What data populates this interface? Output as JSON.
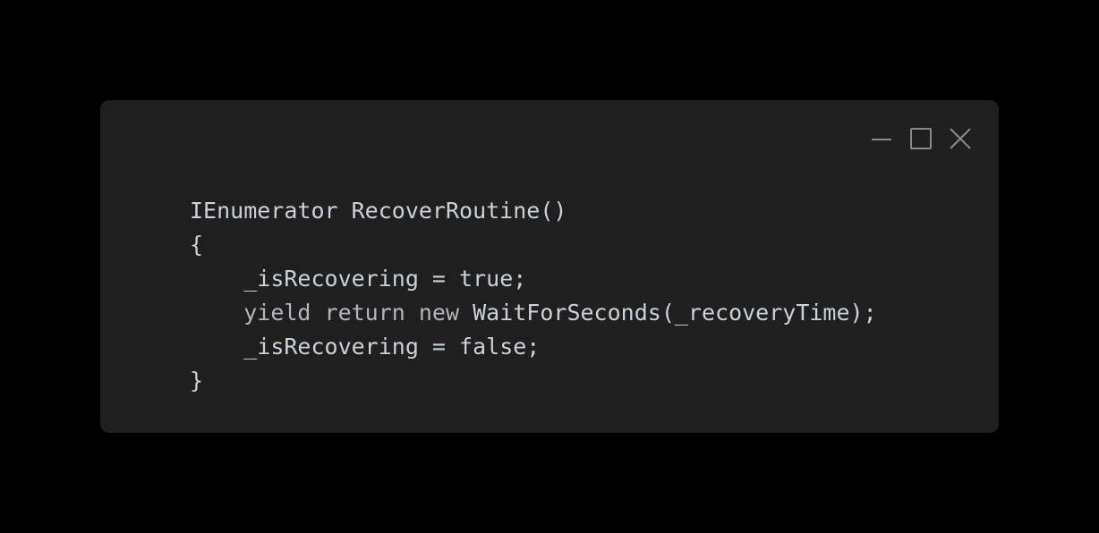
{
  "window": {
    "controls": {
      "minimize_icon": "minimize-icon",
      "maximize_icon": "maximize-icon",
      "close_icon": "close-icon"
    }
  },
  "code": {
    "lines": [
      {
        "indent": "",
        "text": "IEnumerator RecoverRoutine()"
      },
      {
        "indent": "",
        "text": "{"
      },
      {
        "indent": "    ",
        "text": "_isRecovering = true;"
      },
      {
        "indent": "    ",
        "kw": "yield return new",
        "text": " WaitForSeconds(_recoveryTime);"
      },
      {
        "indent": "    ",
        "text": "_isRecovering = false;"
      },
      {
        "indent": "",
        "text": "}"
      }
    ]
  },
  "colors": {
    "background": "#000000",
    "window": "#1f1f1f",
    "code_text": "#c9d1d9",
    "icon": "#8a8a8a"
  }
}
